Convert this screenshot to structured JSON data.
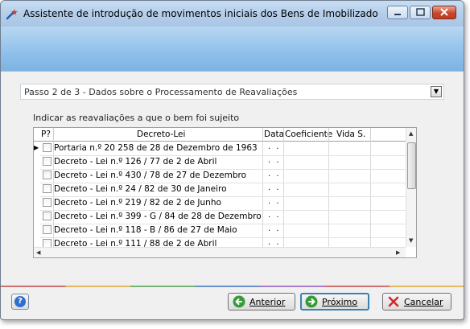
{
  "window": {
    "title": "Assistente de introdução de movimentos iniciais dos Bens de Imobilizado",
    "icon": "wizard-wand-icon"
  },
  "step": {
    "label": "Passo 2 de 3 - Dados sobre o Processamento de Reavaliações"
  },
  "instruction": "Indicar as reavaliações a que o bem foi sujeito",
  "grid": {
    "columns": [
      "P?",
      "Decreto-Lei",
      "Data",
      "Coeficiente",
      "Vida S."
    ],
    "rows": [
      {
        "text": "Portaria n.º 20 258 de 28 de Dezembro de 1963",
        "date": ". .",
        "current": true
      },
      {
        "text": "Decreto - Lei n.º 126 / 77 de 2 de Abril",
        "date": ". ."
      },
      {
        "text": "Decreto - Lei n.º 430 / 78 de 27 de Dezembro",
        "date": ". ."
      },
      {
        "text": "Decreto - Lei n.º 24 / 82 de 30 de Janeiro",
        "date": ". ."
      },
      {
        "text": "Decreto - Lei n.º 219 / 82 de 2 de Junho",
        "date": ". ."
      },
      {
        "text": "Decreto - Lei n.º 399 - G / 84 de 28 de Dezembro",
        "date": ". ."
      },
      {
        "text": "Decreto - Lei n.º 118 - B / 86 de 27 de Maio",
        "date": ". ."
      },
      {
        "text": "Decreto - Lei n.º 111 / 88 de 2 de Abril",
        "date": ". ."
      }
    ]
  },
  "buttons": {
    "previous": "Anterior",
    "next": "Próximo",
    "cancel": "Cancelar"
  },
  "colors": {
    "banner": "#8fc0ea",
    "next_border": "#3c7fb1",
    "cancel_icon": "#d42a2a",
    "arrow_icon": "#3a9a3a"
  }
}
